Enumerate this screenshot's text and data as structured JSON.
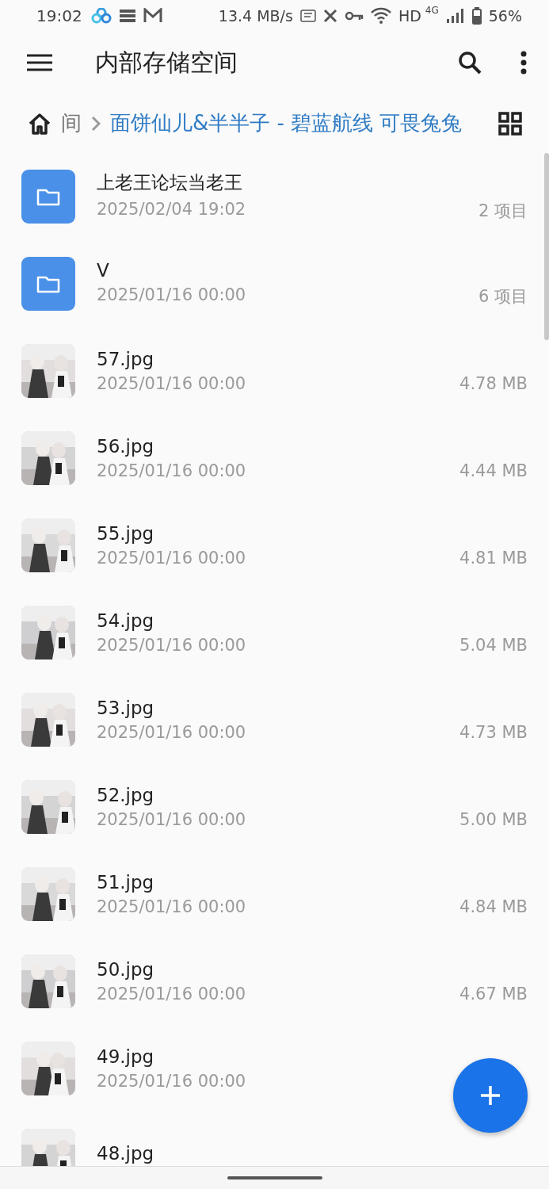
{
  "status_bar": {
    "time": "19:02",
    "speed": "13.4 MB/s",
    "hd": "HD",
    "network": "4G",
    "battery": "56%"
  },
  "app_bar": {
    "title": "内部存储空间"
  },
  "breadcrumb": [
    {
      "label": "间",
      "selected": false
    },
    {
      "label": "面饼仙儿&半半子 - 碧蓝航线 可畏兔兔",
      "selected": true
    }
  ],
  "files": [
    {
      "kind": "folder",
      "name": "上老王论坛当老王",
      "date": "2025/02/04 19:02",
      "detail": "2 项目"
    },
    {
      "kind": "folder",
      "name": "V",
      "date": "2025/01/16 00:00",
      "detail": "6 项目"
    },
    {
      "name": "57.jpg",
      "date": "2025/01/16 00:00",
      "detail": "4.78 MB"
    },
    {
      "name": "56.jpg",
      "date": "2025/01/16 00:00",
      "detail": "4.44 MB"
    },
    {
      "name": "55.jpg",
      "date": "2025/01/16 00:00",
      "detail": "4.81 MB"
    },
    {
      "name": "54.jpg",
      "date": "2025/01/16 00:00",
      "detail": "5.04 MB"
    },
    {
      "name": "53.jpg",
      "date": "2025/01/16 00:00",
      "detail": "4.73 MB"
    },
    {
      "name": "52.jpg",
      "date": "2025/01/16 00:00",
      "detail": "5.00 MB"
    },
    {
      "name": "51.jpg",
      "date": "2025/01/16 00:00",
      "detail": "4.84 MB"
    },
    {
      "name": "50.jpg",
      "date": "2025/01/16 00:00",
      "detail": "4.67 MB"
    },
    {
      "name": "49.jpg",
      "date": "2025/01/16 00:00"
    },
    {
      "name": "48.jpg"
    }
  ]
}
